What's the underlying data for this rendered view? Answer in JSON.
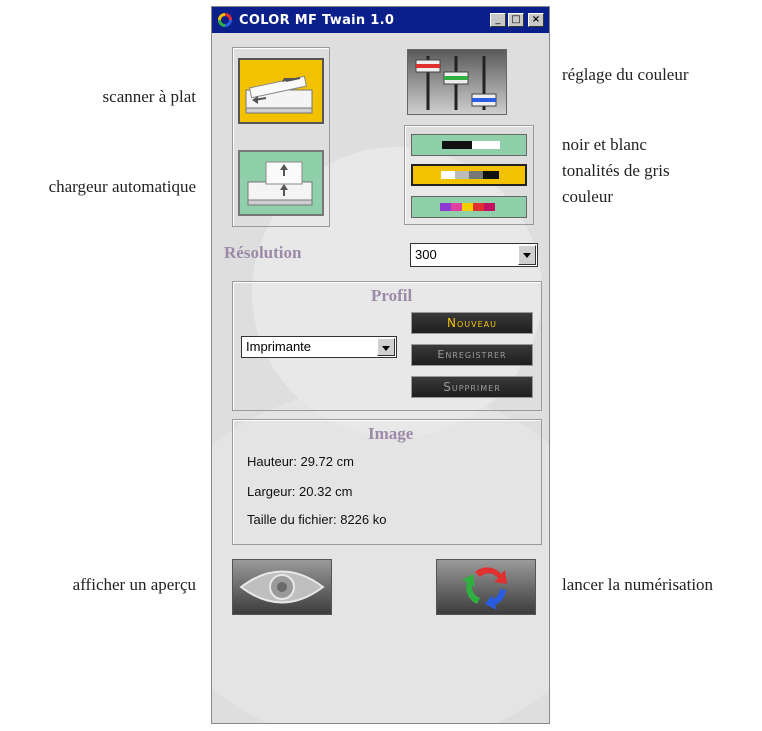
{
  "window": {
    "title": "COLOR MF Twain 1.0",
    "minimize_symbol": "_",
    "maximize_symbol": "□",
    "close_symbol": "×"
  },
  "callouts": {
    "flatbed": "scanner à plat",
    "adf": "chargeur automatique",
    "color_adjust": "réglage du couleur",
    "bw": "noir et blanc",
    "grayscale": "tonalités de gris",
    "color": "couleur",
    "preview": "afficher un aperçu",
    "scan": "lancer la numérisation"
  },
  "resolution": {
    "label": "Résolution",
    "value": "300"
  },
  "profile": {
    "heading": "Profil",
    "selected": "Imprimante",
    "new_label": "Nouveau",
    "save_label": "Enregistrer",
    "delete_label": "Supprimer"
  },
  "image_info": {
    "heading": "Image",
    "height": "Hauteur: 29.72 cm",
    "width": "Largeur: 20.32 cm",
    "filesize": "Taille du fichier: 8226 ko"
  },
  "colors": {
    "titlebar": "#0b1f8a",
    "active": "#f2c200",
    "inactive": "#8fcfaa",
    "heading_purple": "#9b8aa8",
    "new_text": "#f2c200",
    "disabled_text": "#9a9a9a"
  },
  "icons": [
    "app-icon",
    "flatbed-scanner-icon",
    "adf-scanner-icon",
    "sliders-icon",
    "eye-icon",
    "refresh-arrows-icon"
  ]
}
